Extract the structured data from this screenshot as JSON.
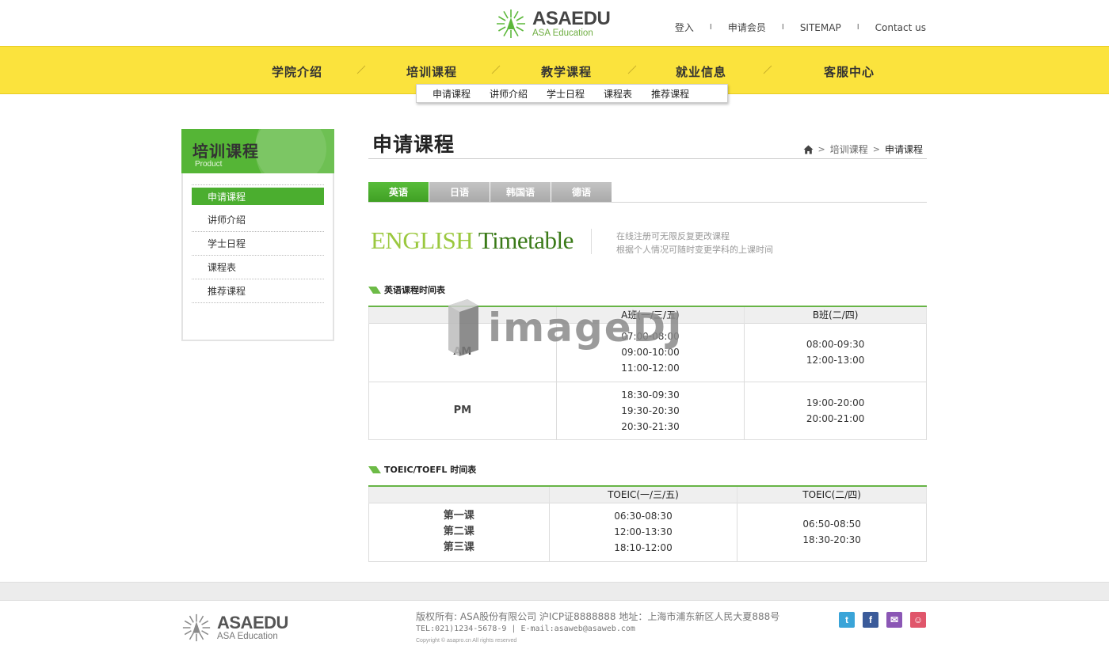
{
  "header": {
    "logo_name": "ASAEDU",
    "logo_sub": "ASA Education",
    "top_links": [
      "登入",
      "申请会员",
      "SITEMAP",
      "Contact us"
    ],
    "top_sep": "I"
  },
  "gnb": {
    "items": [
      "学院介绍",
      "培训课程",
      "教学课程",
      "就业信息",
      "客服中心"
    ],
    "subnav": [
      "申请课程",
      "讲师介绍",
      "学士日程",
      "课程表",
      "推荐课程"
    ]
  },
  "lnb": {
    "title": "培训课程",
    "subtitle": "Product",
    "items": [
      "申请课程",
      "讲师介绍",
      "学士日程",
      "课程表",
      "推荐课程"
    ],
    "active_index": 0
  },
  "content": {
    "page_title": "申请课程",
    "breadcrumb": [
      "培训课程",
      "申请课程"
    ],
    "tabs": [
      "英语",
      "日语",
      "韩国语",
      "德语"
    ],
    "eng_title_light": "ENGLISH",
    "eng_title_dark": "Timetable",
    "desc": [
      "在线注册可无限反复更改课程",
      "根据个人情况可随时变更学科的上课时间"
    ],
    "table1": {
      "title": "英语课程时间表",
      "headers": [
        "",
        "A班(一/三/五)",
        "B班(二/四)"
      ],
      "rows": [
        {
          "label": "AM",
          "a": [
            "07:00-08:00",
            "09:00-10:00",
            "11:00-12:00"
          ],
          "b": [
            "08:00-09:30",
            "12:00-13:00"
          ]
        },
        {
          "label": "PM",
          "a": [
            "18:30-09:30",
            "19:30-20:30",
            "20:30-21:30"
          ],
          "b": [
            "19:00-20:00",
            "20:00-21:00"
          ]
        }
      ]
    },
    "table2": {
      "title": "TOEIC/TOEFL 时间表",
      "headers": [
        "",
        "TOEIC(一/三/五)",
        "TOEIC(二/四)"
      ],
      "labels": [
        "第一课",
        "第二课",
        "第三课"
      ],
      "a": [
        "06:30-08:30",
        "12:00-13:30",
        "18:10-12:00"
      ],
      "b": [
        "06:50-08:50",
        "18:30-20:30"
      ]
    }
  },
  "watermark": "imageDJ",
  "footer": {
    "logo_name": "ASAEDU",
    "logo_sub": "ASA Education",
    "line1": "版权所有: ASA股份有限公司 沪ICP证8888888 地址：上海市浦东新区人民大夏888号",
    "line2": "TEL:021)1234-5678-9 | E-mail:asaweb@asaweb.com",
    "line3": "Copyright © asapro.cn All rights reserved",
    "social": [
      {
        "name": "twitter-icon",
        "glyph": "t",
        "color": "#3aa4d8"
      },
      {
        "name": "facebook-icon",
        "glyph": "f",
        "color": "#3b5b9a"
      },
      {
        "name": "messenger-icon",
        "glyph": "✉",
        "color": "#8b57b5"
      },
      {
        "name": "weibo-icon",
        "glyph": "☺",
        "color": "#e0566b"
      }
    ]
  },
  "colors": {
    "brand_green": "#55b536",
    "gnb_yellow": "#fbe33d"
  }
}
